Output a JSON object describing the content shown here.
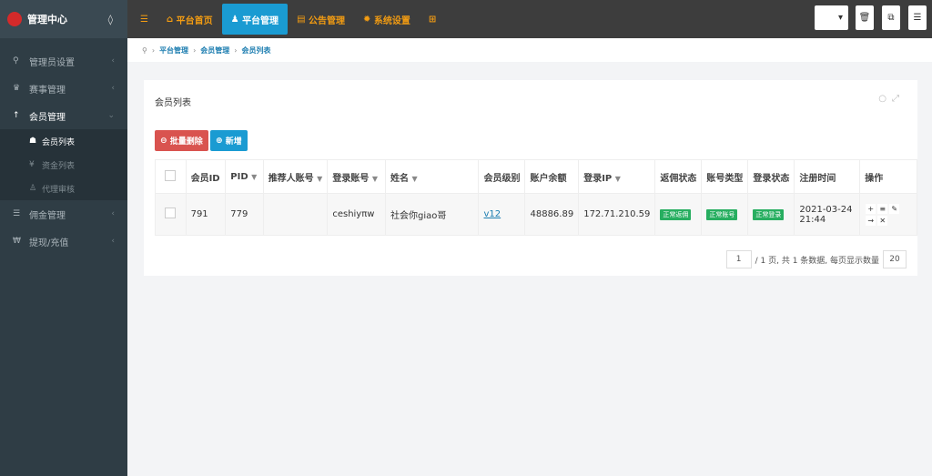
{
  "brand": {
    "title": "管理中心"
  },
  "sidebar": {
    "items": [
      {
        "label": "管理员设置",
        "icon": "key-icon"
      },
      {
        "label": "赛事管理",
        "icon": "trophy-icon"
      },
      {
        "label": "会员管理",
        "icon": "user-icon"
      },
      {
        "label": "佣金管理",
        "icon": "database-icon"
      },
      {
        "label": "提现/充值",
        "icon": "won-icon"
      }
    ],
    "sub": [
      {
        "label": "会员列表",
        "icon": "users-icon"
      },
      {
        "label": "资金列表",
        "icon": "yen-icon"
      },
      {
        "label": "代理审核",
        "icon": "user-check-icon"
      }
    ]
  },
  "topnav": {
    "items": [
      "平台首页",
      "平台管理",
      "公告管理",
      "系统设置"
    ],
    "active": "平台管理"
  },
  "breadcrumb": [
    "平台管理",
    "会员管理",
    "会员列表"
  ],
  "panel": {
    "title": "会员列表",
    "delete_label": "批量删除",
    "add_label": "新增"
  },
  "table": {
    "headers": [
      "会员ID",
      "PID",
      "推荐人账号",
      "登录账号",
      "姓名",
      "会员级别",
      "账户余额",
      "登录IP",
      "返佣状态",
      "账号类型",
      "登录状态",
      "注册时间",
      "操作"
    ],
    "rows": [
      {
        "id": "791",
        "pid": "779",
        "referrer": "",
        "account": "ceshiyπw",
        "name": "社会你giao哥",
        "level": "v12",
        "balance": "48886.89",
        "ip": "172.71.210.59",
        "rebate": "正常返佣",
        "type": "正常账号",
        "login": "正常登录",
        "date": "2021-03-24",
        "time": "21:44"
      }
    ]
  },
  "pager": {
    "page": "1",
    "text": "/ 1 页, 共 1 条数据, 每页显示数量",
    "per_page": "20"
  },
  "colors": {
    "accent": "#1a9bd2",
    "nav": "#f39c12",
    "danger": "#d9534f",
    "success": "#27ae60"
  }
}
